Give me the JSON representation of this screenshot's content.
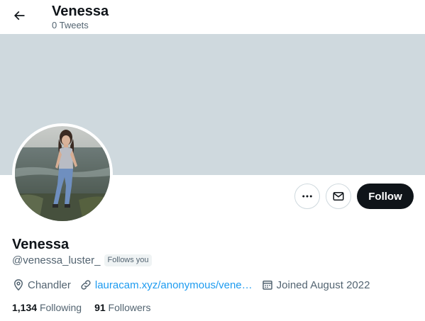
{
  "header": {
    "title": "Venessa",
    "subtitle": "0 Tweets"
  },
  "profile": {
    "name": "Venessa",
    "handle": "@venessa_luster_",
    "follows_you_badge": "Follows you",
    "location": "Chandler",
    "website": "lauracam.xyz/anonymous/vene…",
    "joined": "Joined August 2022",
    "following_count": "1,134",
    "following_label": "Following",
    "followers_count": "91",
    "followers_label": "Followers"
  },
  "actions": {
    "follow_label": "Follow"
  },
  "icons": {
    "back": "arrow-left-icon",
    "more": "more-horizontal-icon",
    "message": "envelope-icon",
    "location": "location-pin-icon",
    "link": "link-icon",
    "calendar": "calendar-icon"
  },
  "colors": {
    "banner": "#cfd9de",
    "follow_button": "#0f1419",
    "link": "#1d9bf0",
    "secondary_text": "#536471"
  }
}
